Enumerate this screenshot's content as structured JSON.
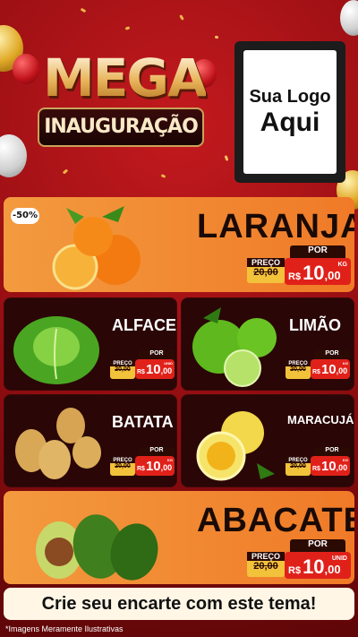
{
  "header": {
    "title_big": "MEGA",
    "title_sub": "INAUGURAÇÃO",
    "logo_line1": "Sua Logo",
    "logo_line2": "Aqui"
  },
  "products": [
    {
      "name": "LARANJA",
      "discount": "-50%",
      "preco_label": "PREÇO",
      "old_price": "20,00",
      "por_label": "POR",
      "currency": "R$",
      "price_int": "10",
      "price_dec": ",00",
      "unit": "KG"
    },
    {
      "name": "ALFACE",
      "preco_label": "PREÇO",
      "old_price": "20,00",
      "por_label": "POR",
      "currency": "R$",
      "price_int": "10",
      "price_dec": ",00",
      "unit": "UNID"
    },
    {
      "name": "LIMÃO",
      "preco_label": "PREÇO",
      "old_price": "20,00",
      "por_label": "POR",
      "currency": "R$",
      "price_int": "10",
      "price_dec": ",00",
      "unit": "KG"
    },
    {
      "name": "BATATA",
      "preco_label": "PREÇO",
      "old_price": "20,00",
      "por_label": "POR",
      "currency": "R$",
      "price_int": "10",
      "price_dec": ",00",
      "unit": "KG"
    },
    {
      "name": "MARACUJÁ",
      "preco_label": "PREÇO",
      "old_price": "20,00",
      "por_label": "POR",
      "currency": "R$",
      "price_int": "10",
      "price_dec": ",00",
      "unit": "KG"
    },
    {
      "name": "ABACATE",
      "preco_label": "PREÇO",
      "old_price": "20,00",
      "por_label": "POR",
      "currency": "R$",
      "price_int": "10",
      "price_dec": ",00",
      "unit": "UNID"
    }
  ],
  "cta": "Crie seu encarte com este tema!",
  "footnote": "*Imagens Meramente Ilustrativas",
  "colors": {
    "background": "#a8141a",
    "card_orange": "#f28a33",
    "card_dark": "#2a0606",
    "price_red": "#e0211a",
    "preco_yellow": "#f3c23b"
  }
}
